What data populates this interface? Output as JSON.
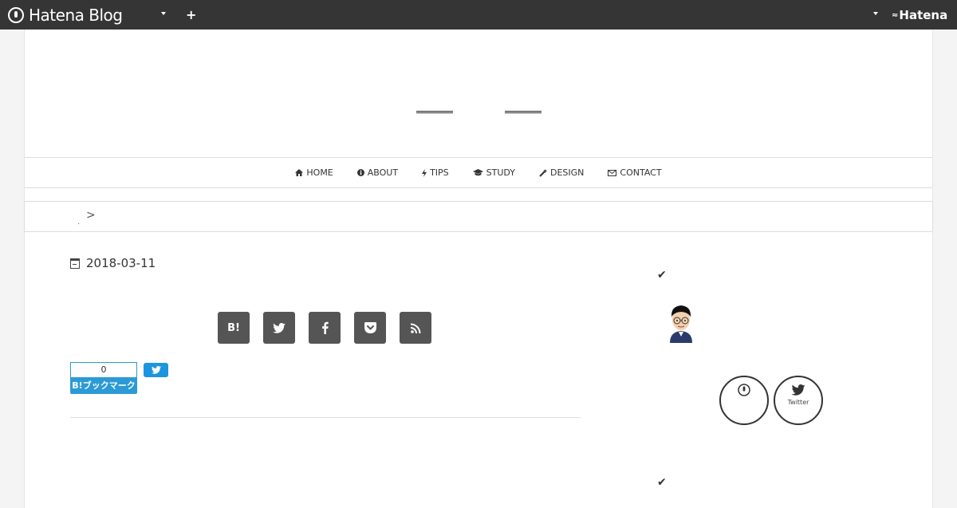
{
  "topbar": {
    "brand": "Hatena Blog",
    "add_icon": "plus-icon",
    "hatena_logo": "Hatena"
  },
  "nav": {
    "items": [
      {
        "icon": "home-icon",
        "label": "HOME"
      },
      {
        "icon": "info-icon",
        "label": "ABOUT"
      },
      {
        "icon": "bolt-icon",
        "label": "TIPS"
      },
      {
        "icon": "graduation-cap-icon",
        "label": "STUDY"
      },
      {
        "icon": "wrench-icon",
        "label": "DESIGN"
      },
      {
        "icon": "envelope-icon",
        "label": "CONTACT"
      }
    ]
  },
  "breadcrumb": {
    "separator": ">"
  },
  "article": {
    "date": "2018-03-11",
    "share_buttons": [
      "hatena-bookmark-icon",
      "twitter-icon",
      "facebook-icon",
      "pocket-icon",
      "rss-icon"
    ],
    "share_hatena_text": "B!",
    "bookmark_count": "0",
    "bookmark_label": "B!ブックマーク"
  },
  "sidebar": {
    "profile_links": [
      {
        "icon": "hatena-icon",
        "label": ""
      },
      {
        "icon": "twitter-icon",
        "label": "Twitter"
      }
    ]
  },
  "colors": {
    "topbar": "#353535",
    "share_button": "#555555",
    "bookmark_blue": "#2b9ad6",
    "twitter_blue": "#1b95e0"
  }
}
